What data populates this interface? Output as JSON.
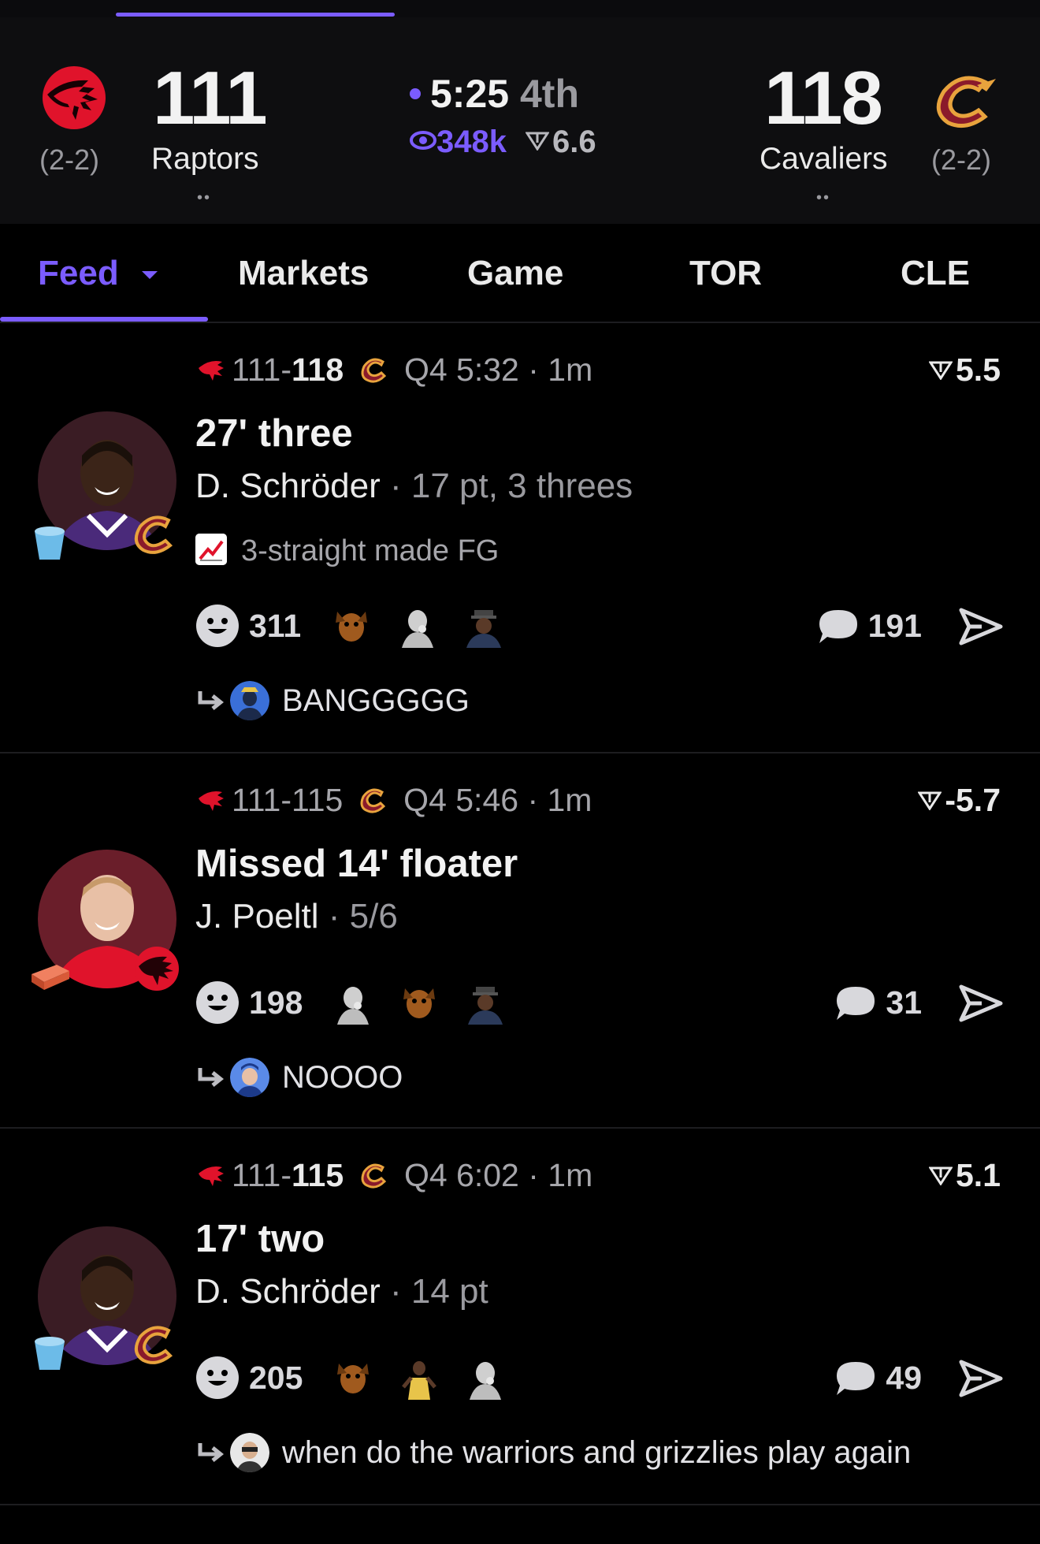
{
  "scoreboard": {
    "away": {
      "score": "111",
      "record": "(2-2)",
      "name": "Raptors",
      "dots": "••",
      "logo": "raptors-logo-icon"
    },
    "home": {
      "score": "118",
      "record": "(2-2)",
      "name": "Cavaliers",
      "dots": "••",
      "logo": "cavaliers-logo-icon"
    },
    "clock": "5:25",
    "period": "4th",
    "viewers": "348k",
    "spread": "6.6"
  },
  "tabs": [
    {
      "label": "Feed",
      "active": true
    },
    {
      "label": "Markets"
    },
    {
      "label": "Game"
    },
    {
      "label": "TOR"
    },
    {
      "label": "CLE"
    }
  ],
  "feed": [
    {
      "score_away": "111",
      "score_home": "118",
      "clock": "Q4 5:32 · 1m",
      "spread": "5.5",
      "title": "27' three",
      "player": "D. Schröder",
      "stat": " · 17 pt, 3 threes",
      "note": "3-straight made FG",
      "reactions": "311",
      "comments": "191",
      "reply": "BANGGGGG"
    },
    {
      "score_away": "111",
      "score_home": "115",
      "clock": "Q4 5:46 · 1m",
      "spread": "-5.7",
      "title": "Missed 14' floater",
      "player": "J. Poeltl",
      "stat": " · 5/6",
      "reactions": "198",
      "comments": "31",
      "reply": "NOOOO"
    },
    {
      "score_away": "111",
      "score_home": "115",
      "clock": "Q4 6:02 · 1m",
      "spread": "5.1",
      "title": "17' two",
      "player": "D. Schröder",
      "stat": " · 14 pt",
      "reactions": "205",
      "comments": "49",
      "reply": "when do the warriors and grizzlies play again"
    }
  ],
  "colors": {
    "accent": "#7b5cff",
    "raptors_red": "#e0132b",
    "cavs_wine": "#8a1a2b",
    "cavs_gold": "#e8a33d"
  }
}
